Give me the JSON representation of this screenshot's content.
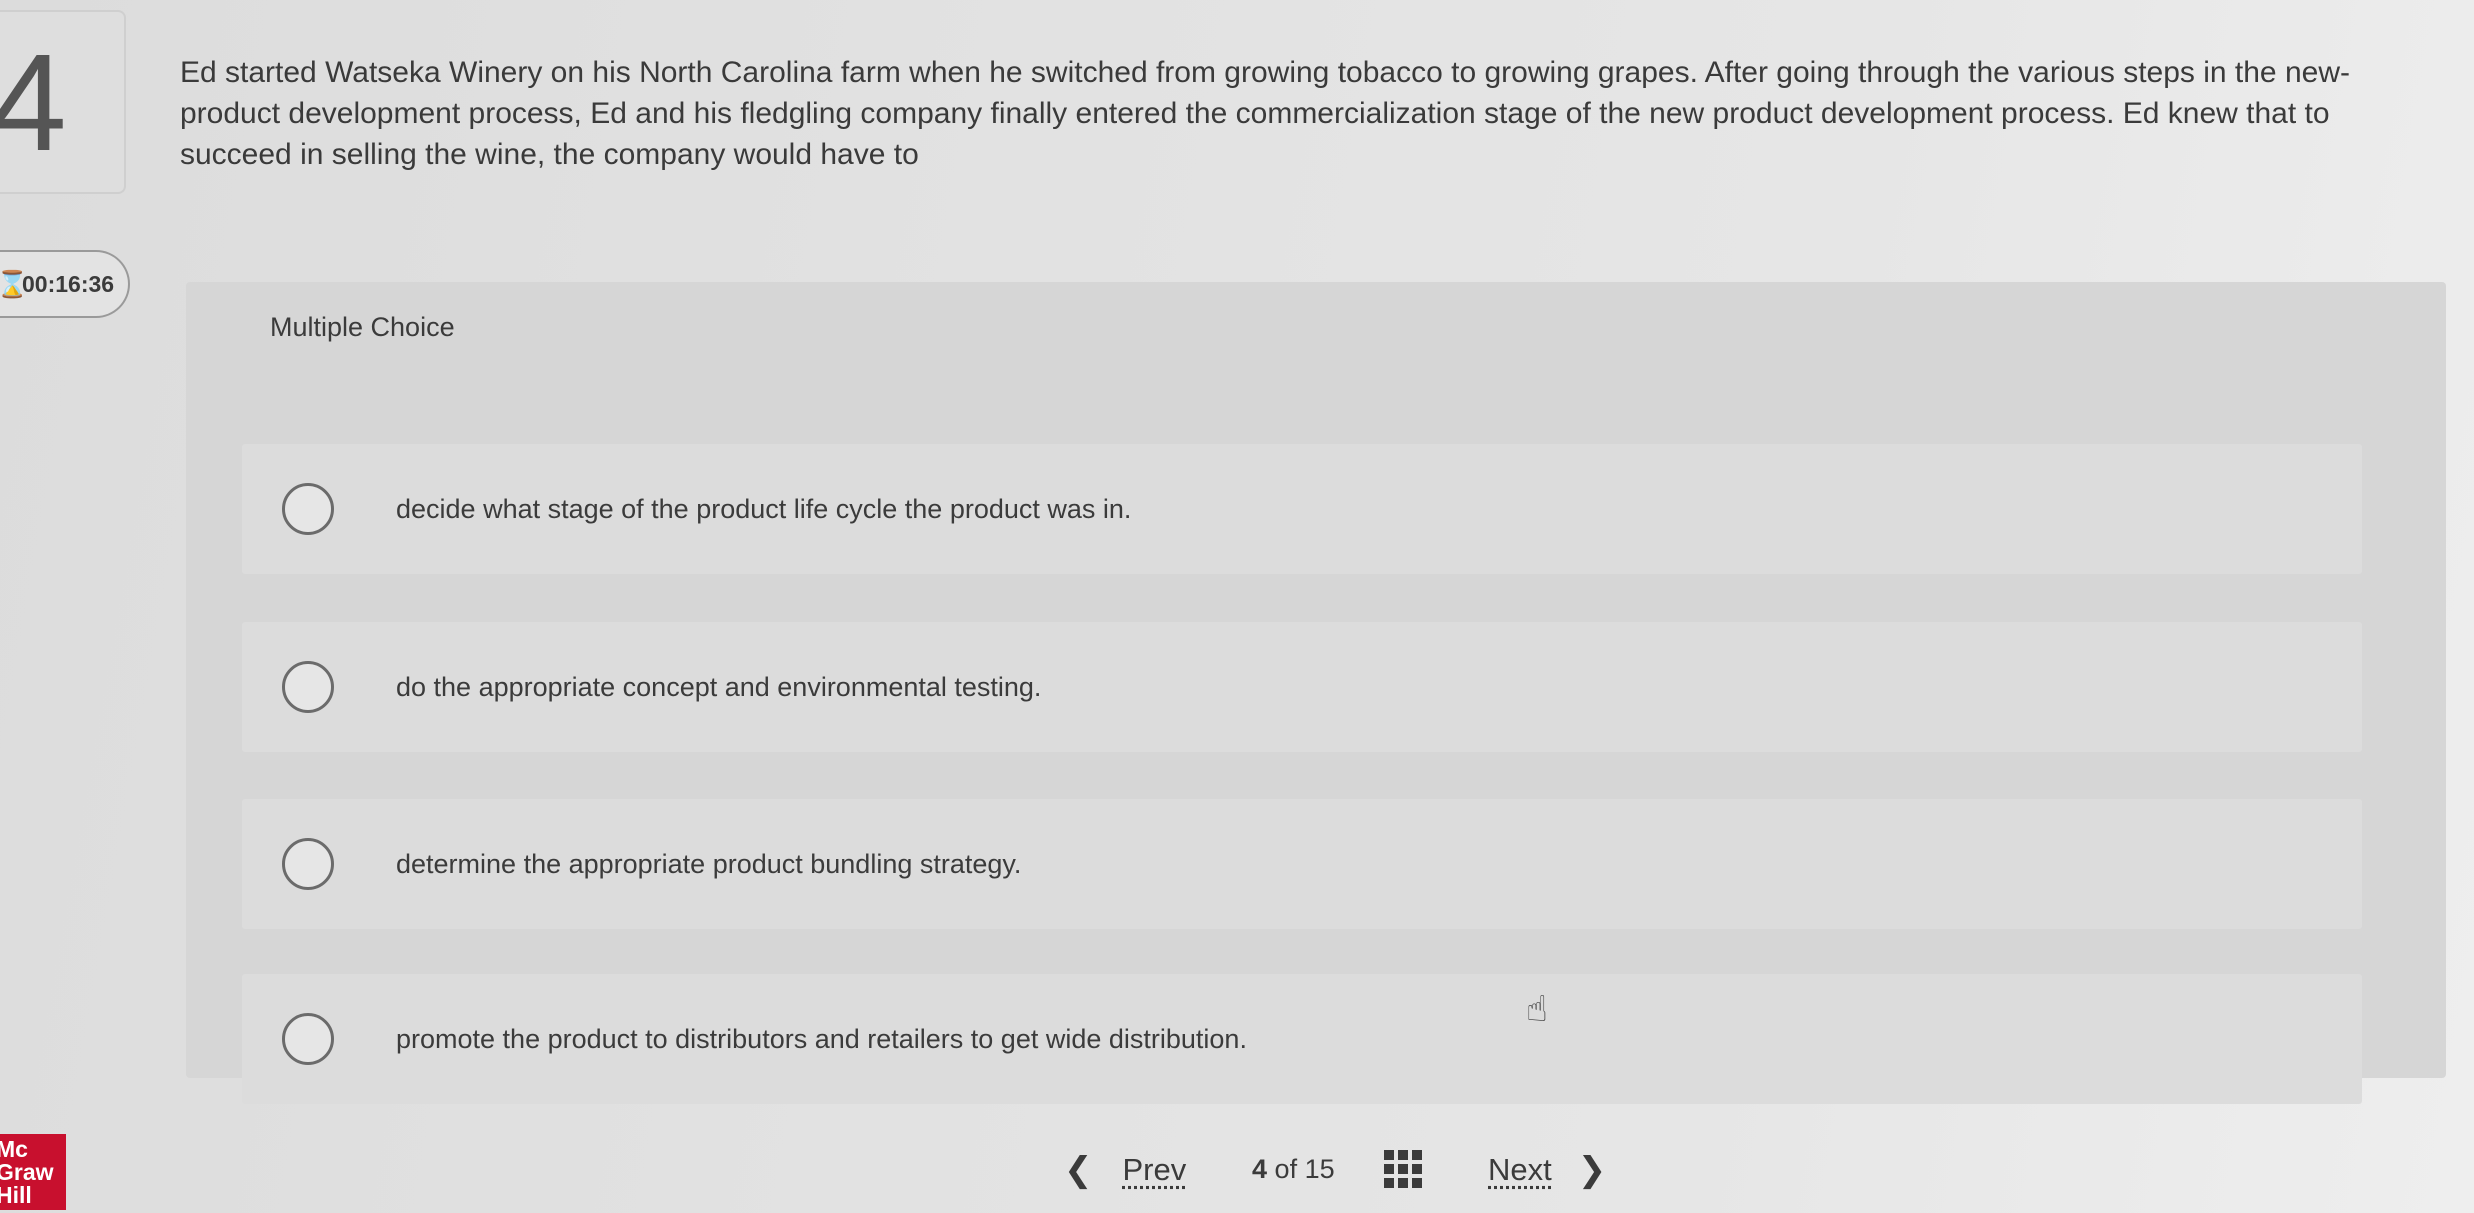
{
  "question": {
    "number": "4",
    "text": "Ed started Watseka Winery on his North Carolina farm when he switched from growing tobacco to growing grapes. After going through the various steps in the new-product development process, Ed and his fledgling company finally entered the commercialization stage of the new product development process. Ed knew that to succeed in selling the wine, the company would have to"
  },
  "timer": {
    "icon": "hourglass-icon",
    "value": "00:16:36"
  },
  "logo": {
    "line1": "Mc",
    "line2": "Graw",
    "line3": "Hill"
  },
  "multiple_choice": {
    "label": "Multiple Choice",
    "options": [
      {
        "text": "decide what stage of the product life cycle the product was in."
      },
      {
        "text": "do the appropriate concept and environmental testing."
      },
      {
        "text": "determine the appropriate product bundling strategy."
      },
      {
        "text": "promote the product to distributors and retailers to get wide distribution."
      }
    ]
  },
  "navigation": {
    "prev_label": "Prev",
    "current": "4",
    "of_label": "of 15",
    "next_label": "Next",
    "grid_icon": "grid-icon"
  }
}
